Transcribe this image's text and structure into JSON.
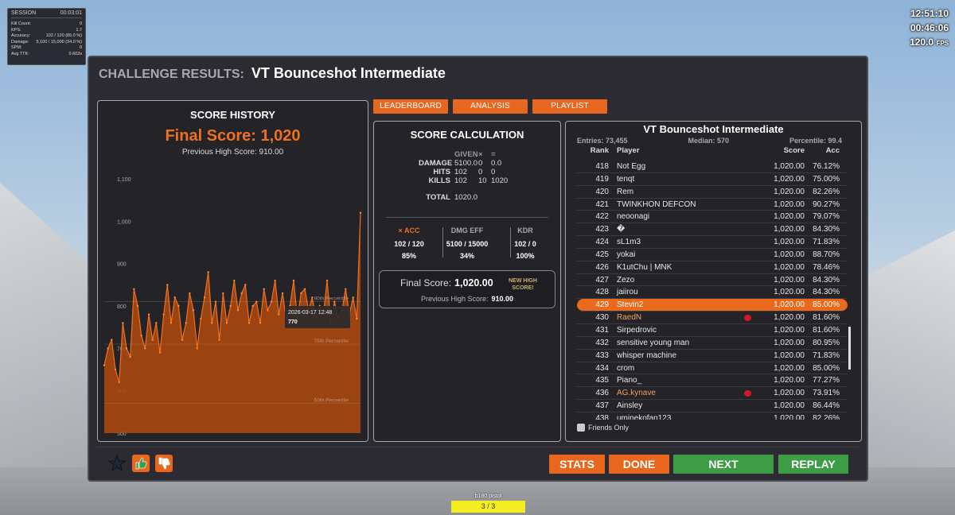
{
  "session": {
    "label": "SESSION",
    "time": "00:03:01",
    "stats": [
      {
        "k": "Kill Count:",
        "v": "0"
      },
      {
        "k": "KPS:",
        "v": "1.7"
      },
      {
        "k": "Accuracy:",
        "v": "102 / 120  (85.0 %)"
      },
      {
        "k": "Damage:",
        "v": "5,100 / 15,000  (34.0 %)"
      },
      {
        "k": "SPM:",
        "v": "0"
      },
      {
        "k": "Avg TTK:",
        "v": "0.602s"
      }
    ]
  },
  "hud": {
    "clock": "12:51:10",
    "timer": "00:46:06",
    "fps": "120.0",
    "fps_unit": "FPS"
  },
  "panel": {
    "title_prefix": "CHALLENGE RESULTS:",
    "title": "VT Bounceshot Intermediate"
  },
  "history": {
    "title": "SCORE HISTORY",
    "final_score": "Final Score: 1,020",
    "previous": "Previous High Score: 910.00",
    "tooltip_date": "2026-03-17 12:48",
    "tooltip_value": "770",
    "percentiles": [
      "90th Percentile",
      "75th Percentile",
      "50th Percentile"
    ]
  },
  "chart_data": {
    "type": "area",
    "title": "SCORE HISTORY",
    "ylim": [
      500,
      1100
    ],
    "yticks": [
      "1,100",
      "1,000",
      "900",
      "800",
      "700",
      "600",
      "500"
    ],
    "percentile_lines": [
      {
        "name": "90th Percentile",
        "y": 810
      },
      {
        "name": "75th Percentile",
        "y": 710
      },
      {
        "name": "50th Percentile",
        "y": 570
      }
    ],
    "values": [
      660,
      700,
      720,
      650,
      620,
      760,
      700,
      680,
      840,
      800,
      730,
      700,
      780,
      720,
      760,
      690,
      780,
      850,
      760,
      820,
      800,
      720,
      760,
      830,
      790,
      700,
      770,
      820,
      880,
      760,
      810,
      720,
      830,
      760,
      800,
      860,
      790,
      830,
      850,
      760,
      800,
      810,
      760,
      840,
      790,
      810,
      860,
      780,
      830,
      770,
      800,
      860,
      770,
      830,
      840,
      790,
      820,
      770,
      800,
      780,
      860,
      760,
      810,
      770,
      790,
      840,
      780,
      820,
      770,
      1020
    ]
  },
  "tabs": [
    "LEADERBOARD",
    "ANALYSIS",
    "PLAYLIST"
  ],
  "calc": {
    "title": "SCORE CALCULATION",
    "headers": [
      "GIVEN",
      "×",
      "="
    ],
    "rows": [
      {
        "k": "DAMAGE",
        "a": "5100.0",
        "b": "0",
        "c": "0.0"
      },
      {
        "k": "HITS",
        "a": "102",
        "b": "0",
        "c": "0"
      },
      {
        "k": "KILLS",
        "a": "102",
        "b": "10",
        "c": "1020"
      }
    ],
    "total_label": "TOTAL",
    "total": "1020.0",
    "acc": {
      "label": "× ACC",
      "v1": "102 / 120",
      "v2": "85%"
    },
    "dmg": {
      "label": "DMG EFF",
      "v1": "5100 / 15000",
      "v2": "34%"
    },
    "kdr": {
      "label": "KDR",
      "v1": "102 / 0",
      "v2": "100%"
    },
    "final_label": "Final Score:",
    "final_value": "1,020.00",
    "new_high_1": "NEW HIGH",
    "new_high_2": "SCORE!",
    "prev_label": "Previous High Score:",
    "prev_value": "910.00"
  },
  "leaderboard": {
    "title": "VT Bounceshot Intermediate",
    "entries": "Entries: 73,455",
    "median": "Median: 570",
    "percentile": "Percentile: 99.4",
    "columns": {
      "rank": "Rank",
      "player": "Player",
      "score": "Score",
      "acc": "Acc"
    },
    "rows": [
      {
        "rank": "418",
        "player": "Not Egg",
        "score": "1,020.00",
        "acc": "76.12%"
      },
      {
        "rank": "419",
        "player": "tenqt",
        "score": "1,020.00",
        "acc": "75.00%"
      },
      {
        "rank": "420",
        "player": "Rem",
        "score": "1,020.00",
        "acc": "82.26%"
      },
      {
        "rank": "421",
        "player": "TWINKHON DEFCON",
        "score": "1,020.00",
        "acc": "90.27%"
      },
      {
        "rank": "422",
        "player": "neoonagi",
        "score": "1,020.00",
        "acc": "79.07%"
      },
      {
        "rank": "423",
        "player": "�",
        "score": "1,020.00",
        "acc": "84.30%"
      },
      {
        "rank": "424",
        "player": "sL1m3",
        "score": "1,020.00",
        "acc": "71.83%"
      },
      {
        "rank": "425",
        "player": "yokai",
        "score": "1,020.00",
        "acc": "88.70%"
      },
      {
        "rank": "426",
        "player": "K1utChu | MNK",
        "score": "1,020.00",
        "acc": "78.46%"
      },
      {
        "rank": "427",
        "player": "Zezo",
        "score": "1,020.00",
        "acc": "84.30%"
      },
      {
        "rank": "428",
        "player": "jaiirou",
        "score": "1,020.00",
        "acc": "84.30%"
      },
      {
        "rank": "429",
        "player": "Stevin2",
        "score": "1,020.00",
        "acc": "85.00%"
      },
      {
        "rank": "430",
        "player": "RaedN",
        "score": "1,020.00",
        "acc": "81.60%"
      },
      {
        "rank": "431",
        "player": "Sirpedrovic",
        "score": "1,020.00",
        "acc": "81.60%"
      },
      {
        "rank": "432",
        "player": "sensitive young man",
        "score": "1,020.00",
        "acc": "80.95%"
      },
      {
        "rank": "433",
        "player": "whisper machine",
        "score": "1,020.00",
        "acc": "71.83%"
      },
      {
        "rank": "434",
        "player": "crom",
        "score": "1,020.00",
        "acc": "85.00%"
      },
      {
        "rank": "435",
        "player": "Piano_",
        "score": "1,020.00",
        "acc": "77.27%"
      },
      {
        "rank": "436",
        "player": "AG.kynave",
        "score": "1,020.00",
        "acc": "73.91%"
      },
      {
        "rank": "437",
        "player": "Ainsley",
        "score": "1,020.00",
        "acc": "86.44%"
      },
      {
        "rank": "438",
        "player": "uminekofan123",
        "score": "1,020.00",
        "acc": "82.26%"
      }
    ],
    "highlight_rank": "429",
    "tagged": [
      "430",
      "436"
    ],
    "friends_only": "Friends Only"
  },
  "buttons": {
    "stats": "STATS",
    "done": "DONE",
    "next": "NEXT",
    "replay": "REPLAY"
  },
  "icons": {
    "favorite": "star-icon",
    "like": "thumbs-up-icon",
    "dislike": "thumbs-down-icon"
  },
  "weapon": {
    "name": "b180 pistol",
    "ammo": "3 / 3"
  },
  "colors": {
    "accent": "#e8671e",
    "green": "#3d9c45",
    "panel": "#2b2b31",
    "ammo": "#f4ee20"
  }
}
